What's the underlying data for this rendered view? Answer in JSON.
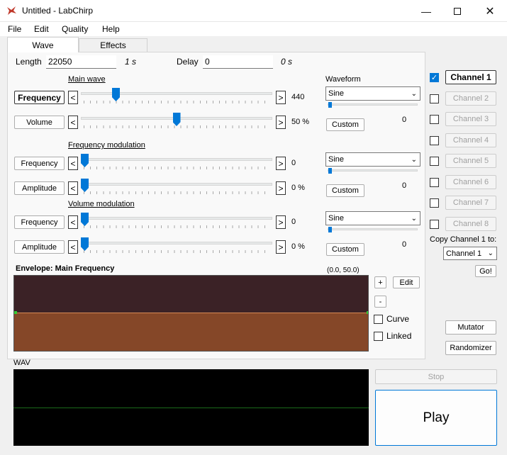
{
  "window": {
    "title": "Untitled - LabChirp"
  },
  "menu": [
    "File",
    "Edit",
    "Quality",
    "Help"
  ],
  "tabs": [
    {
      "label": "Wave",
      "active": true
    },
    {
      "label": "Effects",
      "active": false
    }
  ],
  "wave": {
    "length_label": "Length",
    "length_value": "22050",
    "length_unit": "1 s",
    "delay_label": "Delay",
    "delay_value": "0",
    "delay_unit": "0 s",
    "main_wave_label": "Main wave",
    "waveform_label": "Waveform",
    "rows": [
      {
        "button": "Frequency",
        "value": "440",
        "level": 0.17
      },
      {
        "button": "Volume",
        "value": "50 %",
        "level": 0.5
      },
      {
        "button": "Frequency",
        "value": "0",
        "level": 0.0
      },
      {
        "button": "Amplitude",
        "value": "0 %",
        "level": 0.0
      },
      {
        "button": "Frequency",
        "value": "0",
        "level": 0.0
      },
      {
        "button": "Amplitude",
        "value": "0 %",
        "level": 0.0
      }
    ],
    "freq_mod_label": "Frequency modulation",
    "vol_mod_label": "Volume modulation",
    "waveforms": [
      {
        "selected": "Sine",
        "custom": "Custom",
        "value": "0"
      },
      {
        "selected": "Sine",
        "custom": "Custom",
        "value": "0"
      },
      {
        "selected": "Sine",
        "custom": "Custom",
        "value": "0"
      }
    ]
  },
  "envelope": {
    "title": "Envelope: Main Frequency",
    "coords": "(0.0,  50.0)",
    "plus": "+",
    "minus": "-",
    "edit": "Edit",
    "curve": "Curve",
    "linked": "Linked"
  },
  "channels": [
    {
      "label": "Channel 1",
      "checked": true,
      "active": true
    },
    {
      "label": "Channel 2",
      "checked": false,
      "active": false
    },
    {
      "label": "Channel 3",
      "checked": false,
      "active": false
    },
    {
      "label": "Channel 4",
      "checked": false,
      "active": false
    },
    {
      "label": "Channel 5",
      "checked": false,
      "active": false
    },
    {
      "label": "Channel 6",
      "checked": false,
      "active": false
    },
    {
      "label": "Channel 7",
      "checked": false,
      "active": false
    },
    {
      "label": "Channel 8",
      "checked": false,
      "active": false
    }
  ],
  "copy": {
    "label": "Copy Channel 1 to:",
    "target": "Channel 1",
    "go": "Go!"
  },
  "mutator": "Mutator",
  "randomizer": "Randomizer",
  "wav_label": "WAV",
  "stop": "Stop",
  "play": "Play"
}
